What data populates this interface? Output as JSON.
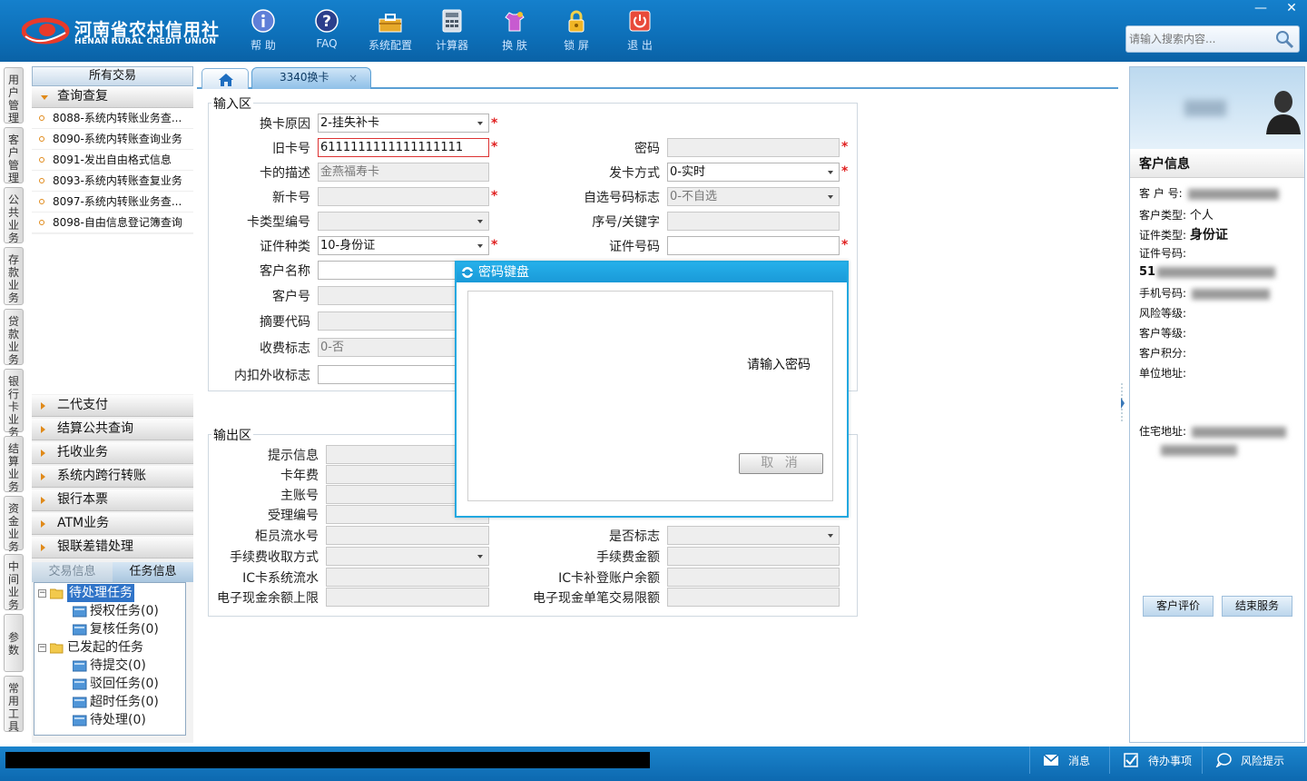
{
  "header": {
    "logo_cn": "河南省农村信用社",
    "logo_en": "HENAN RURAL CREDIT UNION",
    "tools": [
      {
        "label": "帮 助",
        "icon": "info-icon"
      },
      {
        "label": "FAQ",
        "icon": "question-icon"
      },
      {
        "label": "系统配置",
        "icon": "toolbox-icon"
      },
      {
        "label": "计算器",
        "icon": "calculator-icon"
      },
      {
        "label": "换 肤",
        "icon": "shirt-icon"
      },
      {
        "label": "锁 屏",
        "icon": "lock-icon"
      },
      {
        "label": "退 出",
        "icon": "power-icon"
      }
    ],
    "window_controls": [
      "—",
      "✕"
    ],
    "search_placeholder": "请输入搜索内容..."
  },
  "vertical_tabs": [
    "用户管理",
    "客户管理",
    "公共业务",
    "存款业务",
    "贷款业务",
    "银行卡业务",
    "结算业务",
    "资金业务",
    "中间业务",
    "参数",
    "常用工具"
  ],
  "left_panel": {
    "title": "所有交易",
    "open_group": "查询查复",
    "items": [
      "8088-系统内转账业务查...",
      "8090-系统内转账查询业务",
      "8091-发出自由格式信息",
      "8093-系统内转账查复业务",
      "8097-系统内转账业务查...",
      "8098-自由信息登记簿查询"
    ],
    "groups": [
      "二代支付",
      "结算公共查询",
      "托收业务",
      "系统内跨行转账",
      "银行本票",
      "ATM业务",
      "银联差错处理"
    ],
    "tabs": [
      "交易信息",
      "任务信息"
    ],
    "tree": {
      "pending": "待处理任务",
      "pending_children": [
        "授权任务(0)",
        "复核任务(0)"
      ],
      "initiated": "已发起的任务",
      "initiated_children": [
        "待提交(0)",
        "驳回任务(0)",
        "超时任务(0)",
        "待处理(0)"
      ]
    }
  },
  "tabs": {
    "active_label": "3340换卡",
    "close": "×"
  },
  "input_area": {
    "legend": "输入区",
    "fields": {
      "reason_label": "换卡原因",
      "reason_value": "2-挂失补卡",
      "old_card_label": "旧卡号",
      "old_card_value": "6111111111111111111",
      "desc_label": "卡的描述",
      "desc_value": "金燕福寿卡",
      "new_card_label": "新卡号",
      "new_card_value": "",
      "card_type_label": "卡类型编号",
      "card_type_value": "",
      "id_type_label": "证件种类",
      "id_type_value": "10-身份证",
      "cust_name_label": "客户名称",
      "cust_name_value": "",
      "cust_no_label": "客户号",
      "cust_no_value": "",
      "summary_label": "摘要代码",
      "summary_value": "",
      "fee_flag_label": "收费标志",
      "fee_flag_value": "0-否",
      "deduct_label": "内扣外收标志",
      "deduct_value": "",
      "password_label": "密码",
      "password_value": "",
      "issue_label": "发卡方式",
      "issue_value": "0-实时",
      "selfnum_label": "自选号码标志",
      "selfnum_value": "0-不自选",
      "seq_label": "序号/关键字",
      "seq_value": "",
      "id_no_label": "证件号码",
      "id_no_value": ""
    },
    "required_mark": "*"
  },
  "output_area": {
    "legend": "输出区",
    "labels_left": [
      "提示信息",
      "卡年费",
      "主账号",
      "受理编号",
      "柜员流水号",
      "手续费收取方式",
      "IC卡系统流水",
      "电子现金余额上限"
    ],
    "labels_right": [
      "是否标志",
      "手续费金额",
      "IC卡补登账户余额",
      "电子现金单笔交易限额"
    ]
  },
  "dialog": {
    "title": "密码键盘",
    "message": "请输入密码",
    "cancel_label": "取 消"
  },
  "right_panel": {
    "heading": "客户信息",
    "rows": [
      {
        "label": "客 户 号:",
        "value": ""
      },
      {
        "label": "客户类型:",
        "value": "个人"
      },
      {
        "label": "证件类型:",
        "value": "身份证"
      },
      {
        "label": "证件号码:",
        "value": ""
      },
      {
        "label": "",
        "value": "51"
      },
      {
        "label": "手机号码:",
        "value": ""
      },
      {
        "label": "风险等级:",
        "value": ""
      },
      {
        "label": "客户等级:",
        "value": ""
      },
      {
        "label": "客户积分:",
        "value": ""
      },
      {
        "label": "单位地址:",
        "value": ""
      },
      {
        "label": "住宅地址:",
        "value": ""
      }
    ],
    "buttons": [
      "客户评价",
      "结束服务"
    ]
  },
  "statusbar": {
    "items": [
      {
        "label": "消息",
        "icon": "mail-icon"
      },
      {
        "label": "待办事项",
        "icon": "checkbox-icon"
      },
      {
        "label": "风险提示",
        "icon": "chat-bubble-icon"
      }
    ]
  },
  "colors": {
    "header_blue": "#0d6fb8",
    "dialog_border": "#22a8e0",
    "required_red": "#e02020",
    "tree_selected": "#3074c8"
  }
}
